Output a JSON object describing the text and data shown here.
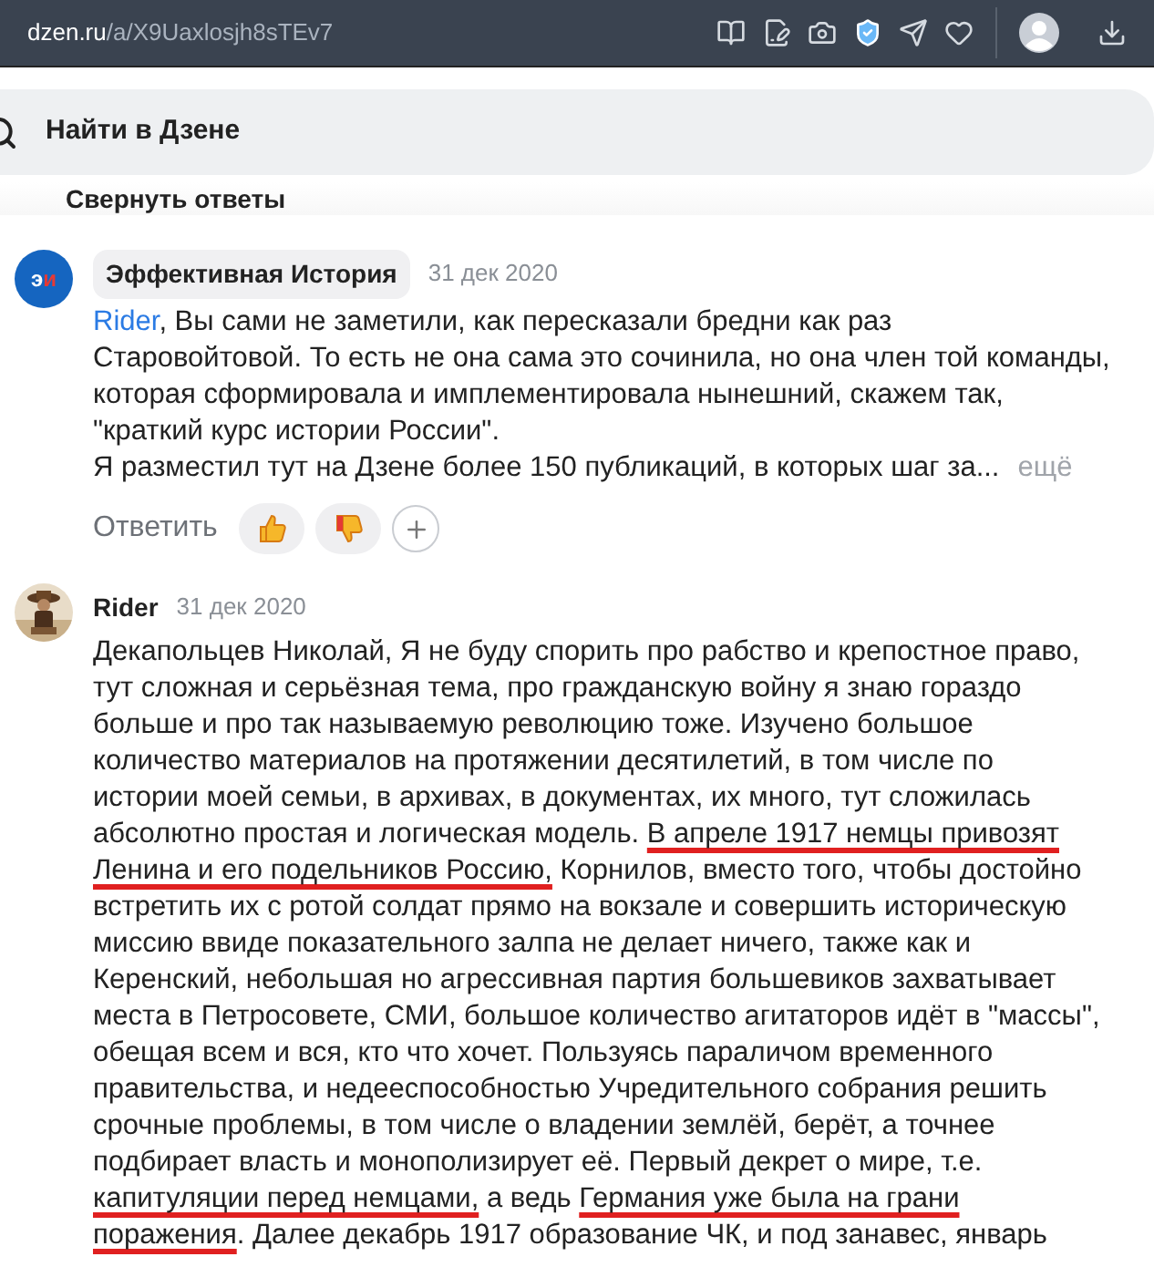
{
  "browser": {
    "url_host": "dzen.ru",
    "url_path": "/a/X9Uaxlosjh8sTEv7"
  },
  "search": {
    "placeholder": "Найти в Дзене"
  },
  "collapse_replies": "Свернуть ответы",
  "comments": [
    {
      "kind": "badge",
      "author": "Эффективная История",
      "avatar_letters": [
        "э",
        "и"
      ],
      "date": "31 дек 2020",
      "mention": "Rider",
      "lines": [
        ", Вы сами не заметили, как пересказали бредни как раз\nСтаровойтовой. То есть не она сама это сочинила, но она член той команды,\nкоторая сформировала и имплементировала нынешний, скажем так,\n\"краткий курс истории России\".",
        "Я разместил тут на Дзене более 150 публикаций, в которых шаг за..."
      ],
      "more": "ещё",
      "reply": "Ответить"
    },
    {
      "kind": "plain",
      "author": "Rider",
      "date": "31 дек 2020",
      "segments": [
        {
          "text": "Декапольцев Николай, Я не буду спорить про рабство и крепостное право,\nтут сложная и серьёзная тема, про гражданскую войну я знаю гораздо\nбольше и про так называемую революцию тоже. Изучено большое\nколичество материалов на протяжении десятилетий, в том числе по\nистории моей семьи, в архивах, в документах, их много, тут сложилась\nабсолютно простая и логическая модель. ",
          "underlined": false
        },
        {
          "text": "В апреле 1917 немцы привозят\nЛенина и его подельников Россию,",
          "underlined": true
        },
        {
          "text": " Корнилов, вместо того, чтобы достойно\nвстретить их с ротой солдат прямо на вокзале и совершить историческую\nмиссию ввиде показательного залпа не делает ничего, также как и\nКеренский, небольшая но агрессивная партия большевиков захватывает\nместа в Петросовете, СМИ, большое количество агитаторов идёт в \"массы\",\nобещая всем и вся, кто что хочет. Пользуясь параличом временного\nправительства, и недееспособностью Учредительного собрания решить\nсрочные проблемы, в том числе о владении землёй, берёт, а точнее\nподбирает власть и монополизирует её. Первый декрет о мире, т.е.\n",
          "underlined": false
        },
        {
          "text": "капитуляции перед немцами,",
          "underlined": true
        },
        {
          "text": " а ведь ",
          "underlined": false
        },
        {
          "text": "Германия уже была на грани\nпоражения",
          "underlined": true
        },
        {
          "text": ". Далее декабрь 1917 образование ЧК, и под занавес, январь",
          "underlined": false
        }
      ]
    }
  ]
}
